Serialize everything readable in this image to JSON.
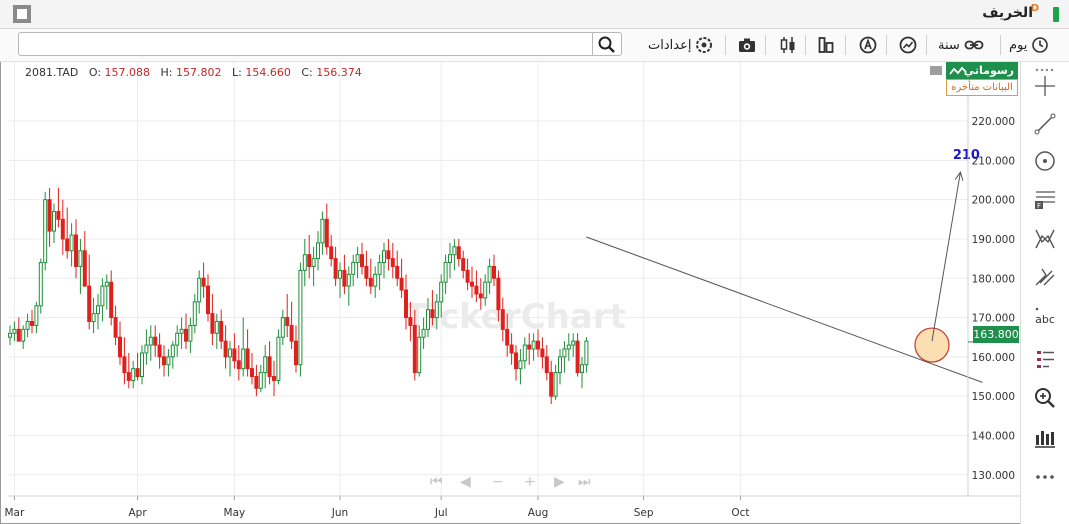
{
  "window": {
    "title": "الخريف",
    "badge": "D"
  },
  "toolbar": {
    "search_placeholder": "",
    "day_label": "يوم",
    "year_label": "سنة",
    "settings_label": "إعدادات"
  },
  "legend": {
    "symbol": "2081.TAD",
    "o_label": "O:",
    "o_value": "157.088",
    "h_label": "H:",
    "h_value": "157.802",
    "l_label": "L:",
    "l_value": "154.660",
    "c_label": "C:",
    "c_value": "156.374"
  },
  "brand": {
    "name": "رسوماتي",
    "delay_notice": "البيانات متأخره"
  },
  "watermark": "TickerChart",
  "colors": {
    "up": "#1f8f3a",
    "down": "#e0201c",
    "accent_green": "#1f8f4c",
    "target_text": "#1a1acc",
    "highlight_fill": "#f9d49a",
    "highlight_stroke": "#c0392b"
  },
  "chart_data": {
    "type": "candlestick",
    "title": "",
    "xlabel": "",
    "ylabel": "",
    "ylim": [
      123,
      227
    ],
    "yticks": [
      "130.000",
      "140.000",
      "150.000",
      "160.000",
      "170.000",
      "180.000",
      "190.000",
      "200.000",
      "210.000",
      "220.000"
    ],
    "last_price_label": "163.800",
    "last_price": 163.8,
    "month_labels": [
      "Mar",
      "Apr",
      "May",
      "Jun",
      "Jul",
      "Aug",
      "Sep",
      "Oct"
    ],
    "month_start_index": [
      1,
      29,
      51,
      75,
      98,
      120,
      144,
      166
    ],
    "candles": [
      [
        165,
        168,
        163,
        166
      ],
      [
        166,
        169,
        164,
        167
      ],
      [
        167,
        170,
        165,
        164
      ],
      [
        164,
        168,
        162,
        167
      ],
      [
        167,
        171,
        165,
        169
      ],
      [
        169,
        172,
        166,
        168
      ],
      [
        168,
        174,
        166,
        173
      ],
      [
        173,
        185,
        171,
        184
      ],
      [
        184,
        202,
        182,
        200
      ],
      [
        200,
        203,
        188,
        192
      ],
      [
        192,
        199,
        189,
        197
      ],
      [
        197,
        203,
        193,
        195
      ],
      [
        195,
        200,
        186,
        190
      ],
      [
        190,
        198,
        185,
        187
      ],
      [
        187,
        194,
        183,
        191
      ],
      [
        191,
        195,
        180,
        183
      ],
      [
        183,
        190,
        176,
        187
      ],
      [
        187,
        192,
        180,
        178
      ],
      [
        178,
        186,
        167,
        169
      ],
      [
        169,
        175,
        166,
        171
      ],
      [
        171,
        176,
        167,
        173
      ],
      [
        173,
        180,
        169,
        178
      ],
      [
        178,
        181,
        172,
        179
      ],
      [
        179,
        182,
        168,
        170
      ],
      [
        170,
        173,
        163,
        165
      ],
      [
        165,
        169,
        158,
        160
      ],
      [
        160,
        165,
        153,
        156
      ],
      [
        156,
        161,
        152,
        154
      ],
      [
        154,
        159,
        152,
        157
      ],
      [
        157,
        161,
        154,
        155
      ],
      [
        155,
        163,
        153,
        161
      ],
      [
        161,
        167,
        158,
        163
      ],
      [
        163,
        168,
        159,
        165
      ],
      [
        165,
        168,
        160,
        163
      ],
      [
        163,
        166,
        157,
        160
      ],
      [
        160,
        163,
        155,
        158
      ],
      [
        158,
        162,
        155,
        160
      ],
      [
        160,
        164,
        157,
        163
      ],
      [
        163,
        168,
        160,
        166
      ],
      [
        166,
        170,
        162,
        167
      ],
      [
        167,
        171,
        162,
        164
      ],
      [
        164,
        170,
        161,
        168
      ],
      [
        168,
        176,
        166,
        174
      ],
      [
        174,
        182,
        171,
        180
      ],
      [
        180,
        184,
        175,
        178
      ],
      [
        178,
        181,
        169,
        171
      ],
      [
        171,
        176,
        163,
        166
      ],
      [
        166,
        171,
        162,
        169
      ],
      [
        169,
        172,
        162,
        164
      ],
      [
        164,
        168,
        157,
        160
      ],
      [
        160,
        164,
        155,
        162
      ],
      [
        162,
        166,
        157,
        159
      ],
      [
        159,
        163,
        154,
        157
      ],
      [
        157,
        170,
        155,
        162
      ],
      [
        162,
        167,
        155,
        157
      ],
      [
        157,
        161,
        153,
        155
      ],
      [
        155,
        158,
        150,
        152
      ],
      [
        152,
        158,
        151,
        156
      ],
      [
        156,
        163,
        152,
        160
      ],
      [
        160,
        164,
        153,
        155
      ],
      [
        155,
        159,
        150,
        154
      ],
      [
        154,
        167,
        153,
        165
      ],
      [
        165,
        172,
        163,
        170
      ],
      [
        170,
        176,
        165,
        168
      ],
      [
        168,
        174,
        162,
        164
      ],
      [
        164,
        168,
        156,
        158
      ],
      [
        158,
        184,
        155,
        182
      ],
      [
        182,
        190,
        178,
        186
      ],
      [
        186,
        191,
        180,
        183
      ],
      [
        183,
        188,
        178,
        185
      ],
      [
        185,
        192,
        182,
        189
      ],
      [
        189,
        197,
        186,
        195
      ],
      [
        195,
        199,
        186,
        188
      ],
      [
        188,
        191,
        183,
        185
      ],
      [
        185,
        188,
        178,
        180
      ],
      [
        180,
        184,
        175,
        182
      ],
      [
        182,
        186,
        176,
        178
      ],
      [
        178,
        183,
        173,
        181
      ],
      [
        181,
        186,
        178,
        184
      ],
      [
        184,
        188,
        180,
        186
      ],
      [
        186,
        189,
        181,
        183
      ],
      [
        183,
        187,
        178,
        180
      ],
      [
        180,
        185,
        176,
        178
      ],
      [
        178,
        183,
        175,
        181
      ],
      [
        181,
        186,
        177,
        184
      ],
      [
        184,
        189,
        180,
        187
      ],
      [
        187,
        190,
        182,
        185
      ],
      [
        185,
        189,
        180,
        183
      ],
      [
        183,
        187,
        178,
        180
      ],
      [
        180,
        185,
        175,
        177
      ],
      [
        177,
        181,
        167,
        170
      ],
      [
        170,
        174,
        164,
        168
      ],
      [
        168,
        172,
        154,
        156
      ],
      [
        156,
        168,
        155,
        165
      ],
      [
        165,
        170,
        162,
        167
      ],
      [
        167,
        175,
        165,
        172
      ],
      [
        172,
        177,
        168,
        170
      ],
      [
        170,
        176,
        167,
        174
      ],
      [
        174,
        181,
        170,
        179
      ],
      [
        179,
        186,
        176,
        184
      ],
      [
        184,
        189,
        180,
        186
      ],
      [
        186,
        190,
        182,
        188
      ],
      [
        188,
        190,
        183,
        185
      ],
      [
        185,
        187,
        180,
        182
      ],
      [
        182,
        185,
        177,
        179
      ],
      [
        179,
        183,
        175,
        178
      ],
      [
        178,
        182,
        174,
        176
      ],
      [
        176,
        180,
        172,
        175
      ],
      [
        175,
        181,
        173,
        179
      ],
      [
        179,
        185,
        176,
        183
      ],
      [
        183,
        186,
        178,
        180
      ],
      [
        180,
        182,
        169,
        172
      ],
      [
        172,
        175,
        164,
        167
      ],
      [
        167,
        171,
        160,
        163
      ],
      [
        163,
        166,
        158,
        161
      ],
      [
        161,
        163,
        154,
        157
      ],
      [
        157,
        162,
        153,
        159
      ],
      [
        159,
        165,
        157,
        163
      ],
      [
        163,
        166,
        158,
        162
      ],
      [
        162,
        166,
        159,
        164
      ],
      [
        164,
        167,
        160,
        162
      ],
      [
        162,
        165,
        157,
        160
      ],
      [
        160,
        163,
        154,
        156
      ],
      [
        156,
        159,
        148,
        150
      ],
      [
        150,
        158,
        149,
        156
      ],
      [
        156,
        162,
        153,
        160
      ],
      [
        160,
        164,
        156,
        162
      ],
      [
        162,
        166,
        159,
        163
      ],
      [
        163,
        166,
        160,
        164
      ],
      [
        164,
        166,
        155,
        156
      ],
      [
        156,
        160,
        152,
        158
      ],
      [
        158,
        165,
        156,
        164
      ]
    ],
    "annotations": {
      "trendline": {
        "start_index": 131,
        "start_value": 190.5,
        "end_index": 221,
        "end_value": 153.5
      },
      "arrow": {
        "from_index": 210,
        "from_value": 164,
        "to_index": 216,
        "to_value": 207
      },
      "target_label": "210",
      "highlight_index": 210,
      "highlight_value": 163
    }
  }
}
